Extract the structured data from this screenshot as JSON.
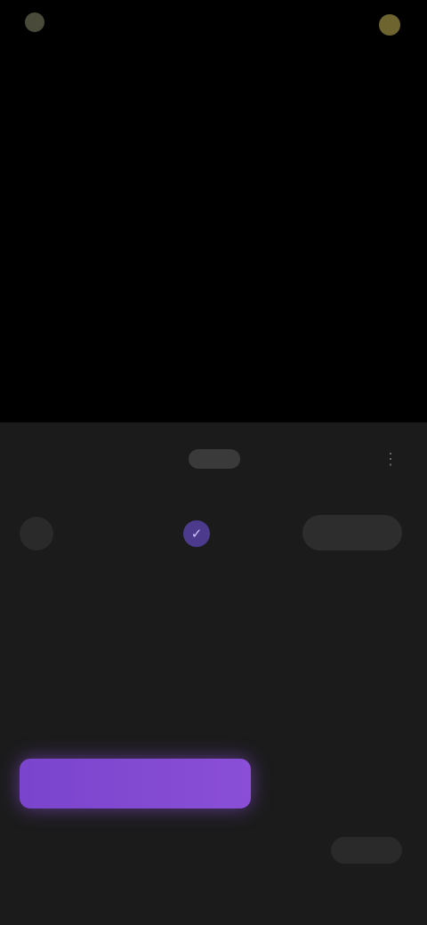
{
  "topbar": {
    "back_label": "",
    "right_label": ""
  },
  "panel": {
    "handle_title": "",
    "more_icon": "more-icon"
  },
  "channel": {
    "name": "",
    "verified_icon": "verified-icon",
    "subscribe_label": ""
  },
  "video": {
    "title": "",
    "meta_short": "",
    "meta_line": "",
    "stats": [
      "",
      ""
    ]
  },
  "cta": {
    "label": ""
  },
  "footer": {
    "line1": "",
    "line2": "",
    "action_label": ""
  },
  "colors": {
    "accent": "#7a44cc",
    "panel_bg": "#1b1b1b",
    "background": "#000000"
  }
}
